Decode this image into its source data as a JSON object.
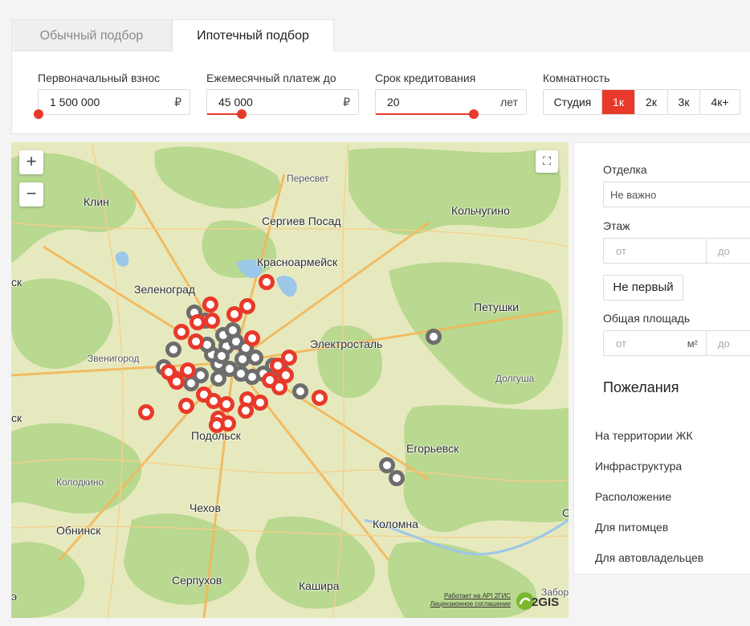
{
  "tabs": [
    {
      "label": "Обычный подбор",
      "active": false
    },
    {
      "label": "Ипотечный подбор",
      "active": true
    }
  ],
  "filters": {
    "down_payment": {
      "label": "Первоначальный взнос",
      "value": "1 500 000",
      "unit": "₽",
      "level": 0.0
    },
    "monthly_payment": {
      "label": "Ежемесячный платеж до",
      "value": "45 000",
      "unit": "₽",
      "level": 0.23
    },
    "term": {
      "label": "Срок кредитования",
      "value": "20",
      "unit": "лет",
      "level": 0.65
    },
    "rooms": {
      "label": "Комнатность",
      "options": [
        "Студия",
        "1к",
        "2к",
        "3к",
        "4к+"
      ],
      "selected": "1к"
    }
  },
  "map": {
    "zoom_in": "+",
    "zoom_out": "−",
    "towns": [
      "Пересвет",
      "Клин",
      "Сергиев Посад",
      "Кольчугино",
      "Красноармейск",
      "Зеленоград",
      "Петушки",
      "Электросталь",
      "Звенигород",
      "Долгуша",
      "Подольск",
      "Егорьевск",
      "Колодкино",
      "Чехов",
      "Обнинск",
      "Коломна",
      "Серпухов",
      "Кашира",
      "Забор"
    ],
    "edge_labels": [
      "ск",
      "ск",
      "С",
      "э"
    ],
    "attribution_line1": "Работает на API 2ГИС",
    "attribution_line2": "Лицензионное соглашение",
    "logo_text": "2GIS",
    "colors": {
      "red_pin": "#e8392a",
      "grey_pin": "#6d6d6d"
    }
  },
  "sidebar": {
    "finish_label": "Отделка",
    "finish_value": "Не важно",
    "floor_label": "Этаж",
    "floor_from": "от",
    "floor_to": "до",
    "not_first": "Не первый",
    "area_label": "Общая площадь",
    "area_from": "от",
    "area_unit": "м²",
    "area_to": "до",
    "wishes_heading": "Пожелания",
    "wishes": [
      "На территории ЖК",
      "Инфраструктура",
      "Расположение",
      "Для питомцев",
      "Для автовладельцев"
    ]
  },
  "accent_color": "#e8392a"
}
